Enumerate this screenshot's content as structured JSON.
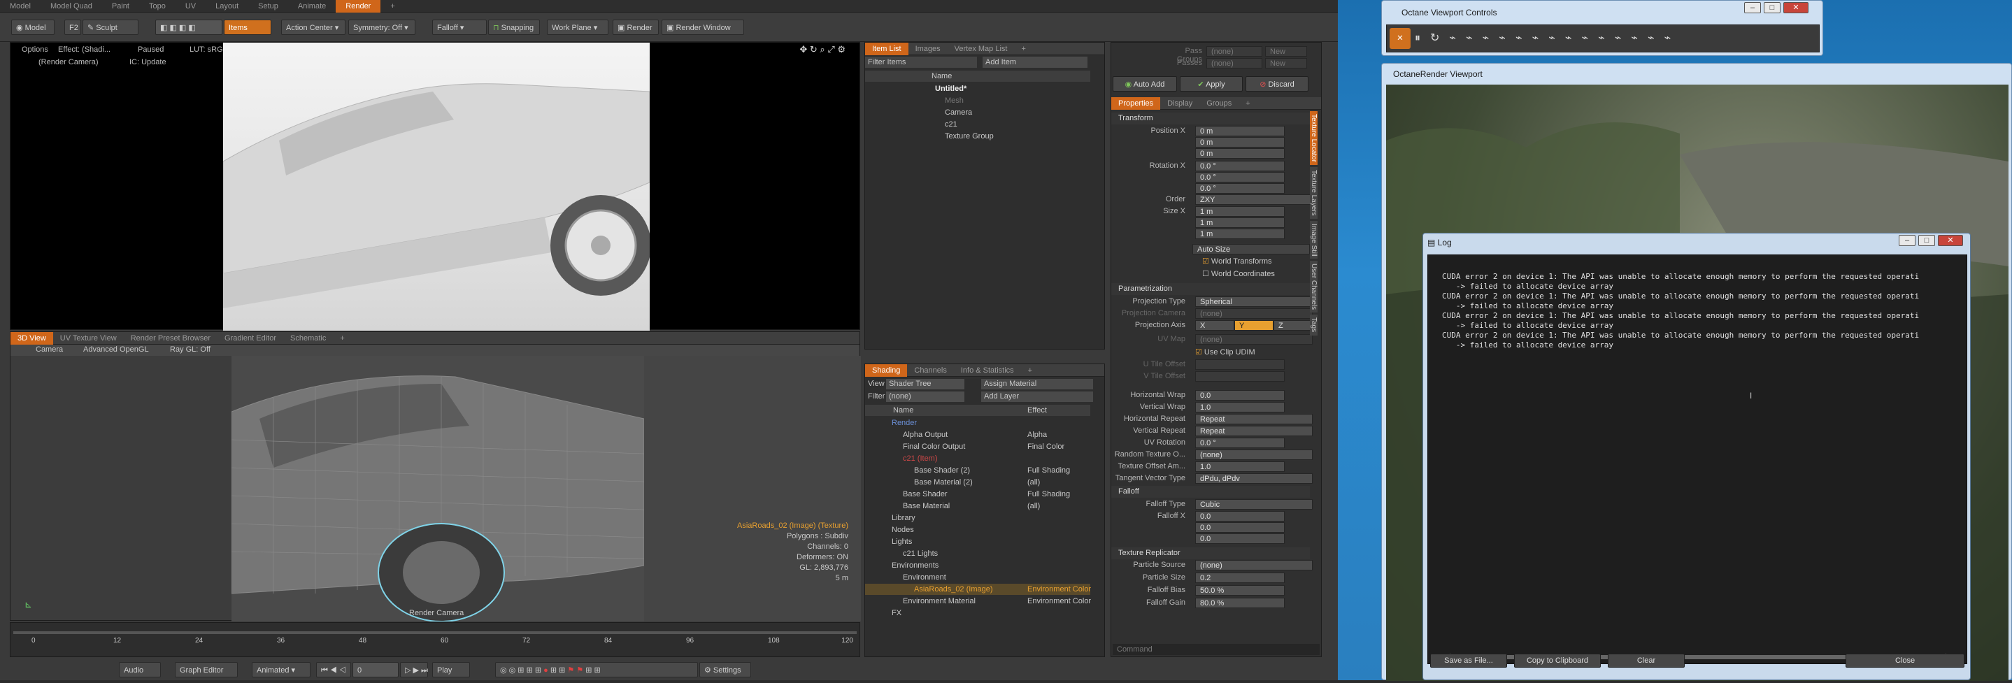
{
  "tabs": [
    "Model",
    "Model Quad",
    "Paint",
    "Topo",
    "UV",
    "Layout",
    "Setup",
    "Animate",
    "Render",
    "+"
  ],
  "toolbar": {
    "model": "Model",
    "f2": "F2",
    "sculpt": "Sculpt",
    "items": "Items",
    "action_center": "Action Center",
    "symmetry": "Symmetry: Off",
    "falloff": "Falloff",
    "snapping": "Snapping",
    "work_plane": "Work Plane",
    "render": "Render",
    "render_window": "Render Window"
  },
  "render_view": {
    "options": "Options",
    "effect": "Effect: (Shadi...",
    "paused": "Paused",
    "lut": "LUT: sRGB",
    "camera": "(Render Camera)",
    "ic": "IC: Update"
  },
  "view3d": {
    "tabs": [
      "3D View",
      "UV Texture View",
      "Render Preset Browser",
      "Gradient Editor",
      "Schematic",
      "+"
    ],
    "camera": "Camera",
    "gl": "Advanced OpenGL",
    "ray": "Ray GL: Off",
    "info": [
      "AsiaRoads_02 (Image) (Texture)",
      "Polygons : Subdiv",
      "Channels: 0",
      "Deformers: ON",
      "GL: 2,893,776",
      "5 m"
    ],
    "footer": "Render Camera"
  },
  "timeline": {
    "ticks": [
      "0",
      "12",
      "24",
      "36",
      "48",
      "60",
      "72",
      "84",
      "96",
      "108",
      "120"
    ],
    "audio": "Audio",
    "graph": "Graph Editor",
    "animated": "Animated",
    "frame": "0",
    "play": "Play",
    "settings": "Settings"
  },
  "itemlist": {
    "tabs": [
      "Item List",
      "Images",
      "Vertex Map List",
      "+"
    ],
    "filter": "Filter Items",
    "add": "Add Item",
    "col": "Name",
    "items": [
      "Untitled*",
      "Mesh",
      "Camera",
      "c21",
      "Texture Group"
    ]
  },
  "shading": {
    "tabs": [
      "Shading",
      "Channels",
      "Info & Statistics",
      "+"
    ],
    "view": "View",
    "view_val": "Shader Tree",
    "assign": "Assign Material",
    "filter": "Filter",
    "filter_val": "(none)",
    "add_layer": "Add Layer",
    "cols": [
      "Name",
      "Effect"
    ],
    "rows": [
      [
        "Render",
        ""
      ],
      [
        "Alpha Output",
        "Alpha"
      ],
      [
        "Final Color Output",
        "Final Color"
      ],
      [
        "c21 (Item)",
        ""
      ],
      [
        "Base Shader (2)",
        "Full Shading"
      ],
      [
        "Base Material (2)",
        "(all)"
      ],
      [
        "Base Shader",
        "Full Shading"
      ],
      [
        "Base Material",
        "(all)"
      ],
      [
        "Library",
        ""
      ],
      [
        "Nodes",
        ""
      ],
      [
        "Lights",
        ""
      ],
      [
        "c21 Lights",
        ""
      ],
      [
        "Environments",
        ""
      ],
      [
        "Environment",
        ""
      ],
      [
        "AsiaRoads_02 (Image)",
        "Environment Color"
      ],
      [
        "Environment Material",
        "Environment Color"
      ],
      [
        "FX",
        ""
      ]
    ]
  },
  "props": {
    "pass_groups": "Pass Groups",
    "passes": "Passes",
    "none": "(none)",
    "new": "New",
    "auto_add": "Auto Add",
    "apply": "Apply",
    "discard": "Discard",
    "tabs": [
      "Properties",
      "Display",
      "Groups",
      "+"
    ],
    "transform": "Transform",
    "pos_label": "Position X",
    "pos": [
      "0 m",
      "0 m",
      "0 m"
    ],
    "rot_label": "Rotation X",
    "rot": [
      "0.0 °",
      "0.0 °",
      "0.0 °"
    ],
    "order_label": "Order",
    "order": "ZXY",
    "size_label": "Size X",
    "size": [
      "1 m",
      "1 m",
      "1 m"
    ],
    "auto_size": "Auto Size",
    "world_t": "World Transforms",
    "world_c": "World Coordinates",
    "param": "Parametrization",
    "proj_type_label": "Projection Type",
    "proj_type": "Spherical",
    "proj_cam_label": "Projection Camera",
    "proj_axis_label": "Projection Axis",
    "axes": [
      "X",
      "Y",
      "Z"
    ],
    "uvmap_label": "UV Map",
    "uvmap": "(none)",
    "use_clip": "Use Clip UDIM",
    "utile": "U Tile Offset",
    "vtile": "V Tile Offset",
    "hwrap_label": "Horizontal Wrap",
    "hwrap": "0.0",
    "vwrap_label": "Vertical Wrap",
    "vwrap": "1.0",
    "hrep_label": "Horizontal Repeat",
    "hrep": "Repeat",
    "vrep_label": "Vertical Repeat",
    "vrep": "Repeat",
    "uvrot_label": "UV Rotation",
    "uvrot": "0.0 °",
    "rand_label": "Random Texture O...",
    "rand": "(none)",
    "tex_off_label": "Texture Offset Am...",
    "tex_off": "1.0",
    "tan_label": "Tangent Vector Type",
    "tan": "dPdu, dPdv",
    "falloff": "Falloff",
    "ftype_label": "Falloff Type",
    "ftype": "Cubic",
    "fx_label": "Falloff X",
    "fvals": [
      "0.0",
      "0.0",
      "0.0"
    ],
    "replic": "Texture Replicator",
    "psrc_label": "Particle Source",
    "psrc": "(none)",
    "psize_label": "Particle Size",
    "psize": "0.2",
    "fbias_label": "Falloff Bias",
    "fbias": "50.0 %",
    "fgain_label": "Falloff Gain",
    "fgain": "80.0 %",
    "side_tabs": [
      "Texture Locator",
      "Texture Layers",
      "Image Still",
      "User Channels",
      "Tags"
    ],
    "command": "Command"
  },
  "octane_controls": {
    "title": "Octane Viewport Controls"
  },
  "octane_viewport": {
    "title": "OctaneRender Viewport"
  },
  "log": {
    "title": "Log",
    "lines": [
      "CUDA error 2 on device 1: The API was unable to allocate enough memory to perform the requested operati",
      "   -> failed to allocate device array",
      "CUDA error 2 on device 1: The API was unable to allocate enough memory to perform the requested operati",
      "   -> failed to allocate device array",
      "CUDA error 2 on device 1: The API was unable to allocate enough memory to perform the requested operati",
      "   -> failed to allocate device array",
      "CUDA error 2 on device 1: The API was unable to allocate enough memory to perform the requested operati",
      "   -> failed to allocate device array"
    ],
    "save": "Save as File...",
    "copy": "Copy to Clipboard",
    "clear": "Clear",
    "close": "Close"
  }
}
